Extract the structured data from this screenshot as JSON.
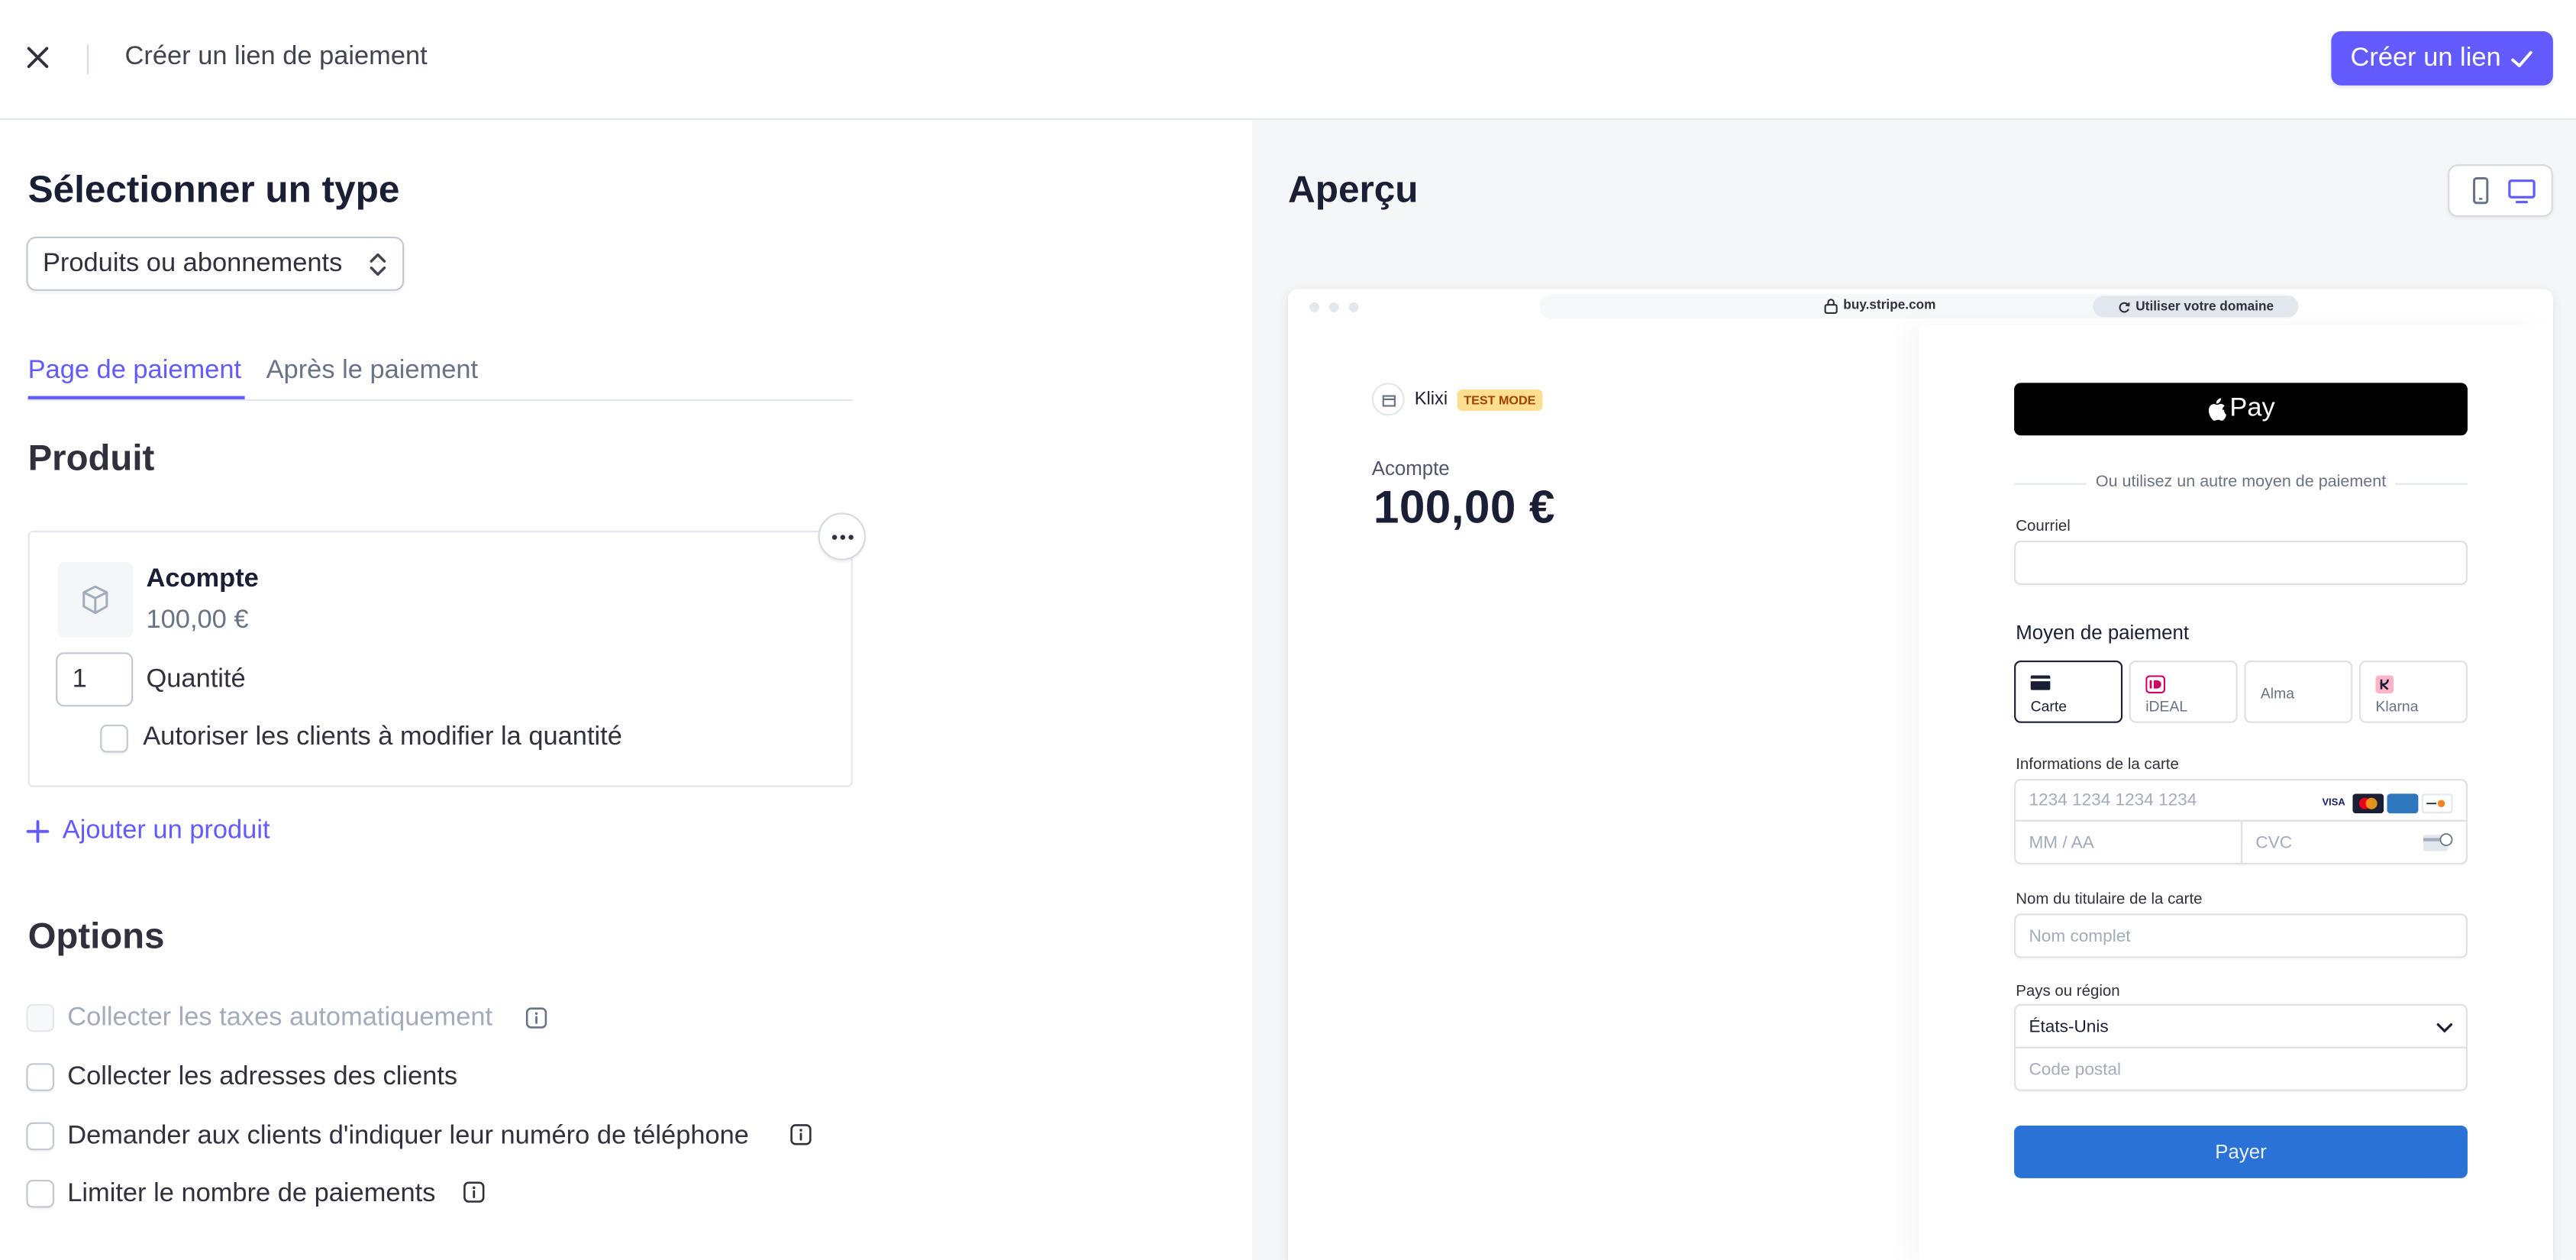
{
  "header": {
    "title": "Créer un lien de paiement",
    "create_label": "Créer un lien"
  },
  "left": {
    "select_type_heading": "Sélectionner un type",
    "type_select_value": "Produits ou abonnements",
    "tabs": [
      {
        "label": "Page de paiement",
        "active": true
      },
      {
        "label": "Après le paiement",
        "active": false
      }
    ],
    "product_heading": "Produit",
    "product": {
      "name": "Acompte",
      "price": "100,00 €",
      "quantity": "1",
      "quantity_label": "Quantité",
      "allow_adjust_label": "Autoriser les clients à modifier la quantité"
    },
    "add_product_label": "Ajouter un produit",
    "options_heading": "Options",
    "options": [
      {
        "label": "Collecter les taxes automatiquement",
        "disabled": true,
        "info": true
      },
      {
        "label": "Collecter les adresses des clients",
        "disabled": false,
        "info": false
      },
      {
        "label": "Demander aux clients d'indiquer leur numéro de téléphone",
        "disabled": false,
        "info": true
      },
      {
        "label": "Limiter le nombre de paiements",
        "disabled": false,
        "info": true
      }
    ]
  },
  "preview": {
    "heading": "Aperçu",
    "url": "buy.stripe.com",
    "domain_label": "Utiliser votre domaine",
    "merchant": "Klixi",
    "test_badge": "TEST MODE",
    "item_label": "Acompte",
    "amount": "100,00 €",
    "apple_pay_label": "Pay",
    "or_text": "Ou utilisez un autre moyen de paiement",
    "email_label": "Courriel",
    "payment_method_heading": "Moyen de paiement",
    "payment_methods": [
      "Carte",
      "iDEAL",
      "Alma",
      "Klarna"
    ],
    "card_info_label": "Informations de la carte",
    "card_number_placeholder": "1234 1234 1234 1234",
    "expiry_placeholder": "MM / AA",
    "cvc_placeholder": "CVC",
    "cardholder_label": "Nom du titulaire de la carte",
    "cardholder_placeholder": "Nom complet",
    "country_label": "Pays ou région",
    "country_value": "États-Unis",
    "postal_placeholder": "Code postal",
    "pay_label": "Payer"
  },
  "colors": {
    "accent": "#635bff",
    "pay_button": "#2a72d6",
    "test_badge_bg": "#ffde92"
  }
}
